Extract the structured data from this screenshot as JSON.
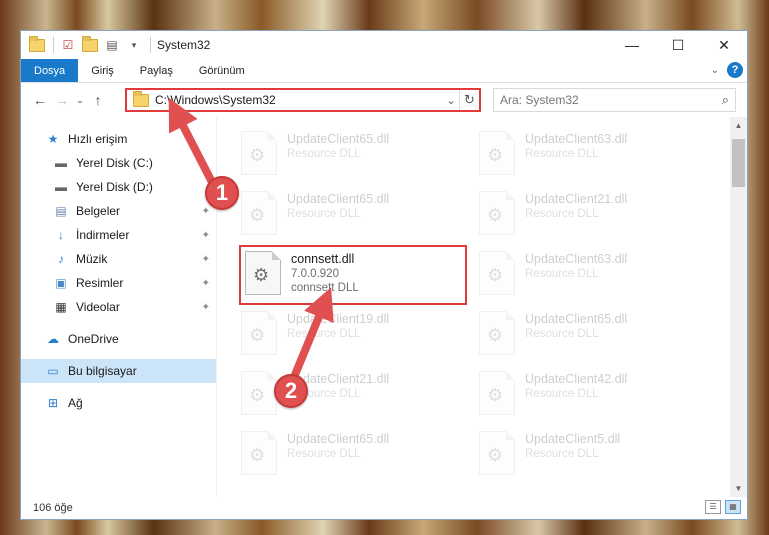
{
  "window": {
    "title": "System32"
  },
  "window_controls": {
    "minimize": "—",
    "maximize": "☐",
    "close": "✕"
  },
  "ribbon": {
    "tabs": [
      "Dosya",
      "Giriş",
      "Paylaş",
      "Görünüm"
    ],
    "help": "?"
  },
  "address": {
    "path": "C:\\Windows\\System32"
  },
  "search": {
    "placeholder": "Ara: System32"
  },
  "sidebar": {
    "quick_access": "Hızlı erişim",
    "items": [
      "Yerel Disk (C:)",
      "Yerel Disk (D:)",
      "Belgeler",
      "İndirmeler",
      "Müzik",
      "Resimler",
      "Videolar"
    ],
    "onedrive": "OneDrive",
    "this_pc": "Bu bilgisayar",
    "network": "Ağ"
  },
  "files": {
    "left": [
      {
        "name": "UpdateClient65.dll",
        "type": "Resource DLL"
      },
      {
        "name": "UpdateClient65.dll",
        "type": "Resource DLL"
      },
      {
        "name": "UpdateClient19.dll",
        "type": "Resource DLL"
      },
      {
        "name": "UpdateClient21.dll",
        "type": "Resource DLL"
      },
      {
        "name": "UpdateClient65.dll",
        "type": "Resource DLL"
      }
    ],
    "right": [
      {
        "name": "UpdateClient63.dll",
        "type": "Resource DLL"
      },
      {
        "name": "UpdateClient21.dll",
        "type": "Resource DLL"
      },
      {
        "name": "UpdateClient63.dll",
        "type": "Resource DLL"
      },
      {
        "name": "UpdateClient65.dll",
        "type": "Resource DLL"
      },
      {
        "name": "UpdateClient42.dll",
        "type": "Resource DLL"
      },
      {
        "name": "UpdateClient5.dll",
        "type": "Resource DLL"
      }
    ],
    "highlighted": {
      "name": "connsett.dll",
      "version": "7.0.0.920",
      "type": "connsett DLL"
    }
  },
  "status": {
    "count": "106 öğe"
  },
  "callouts": [
    "1",
    "2"
  ],
  "colors": {
    "accent": "#1979ca",
    "highlight": "#e03a3a",
    "callout": "#e05050"
  }
}
